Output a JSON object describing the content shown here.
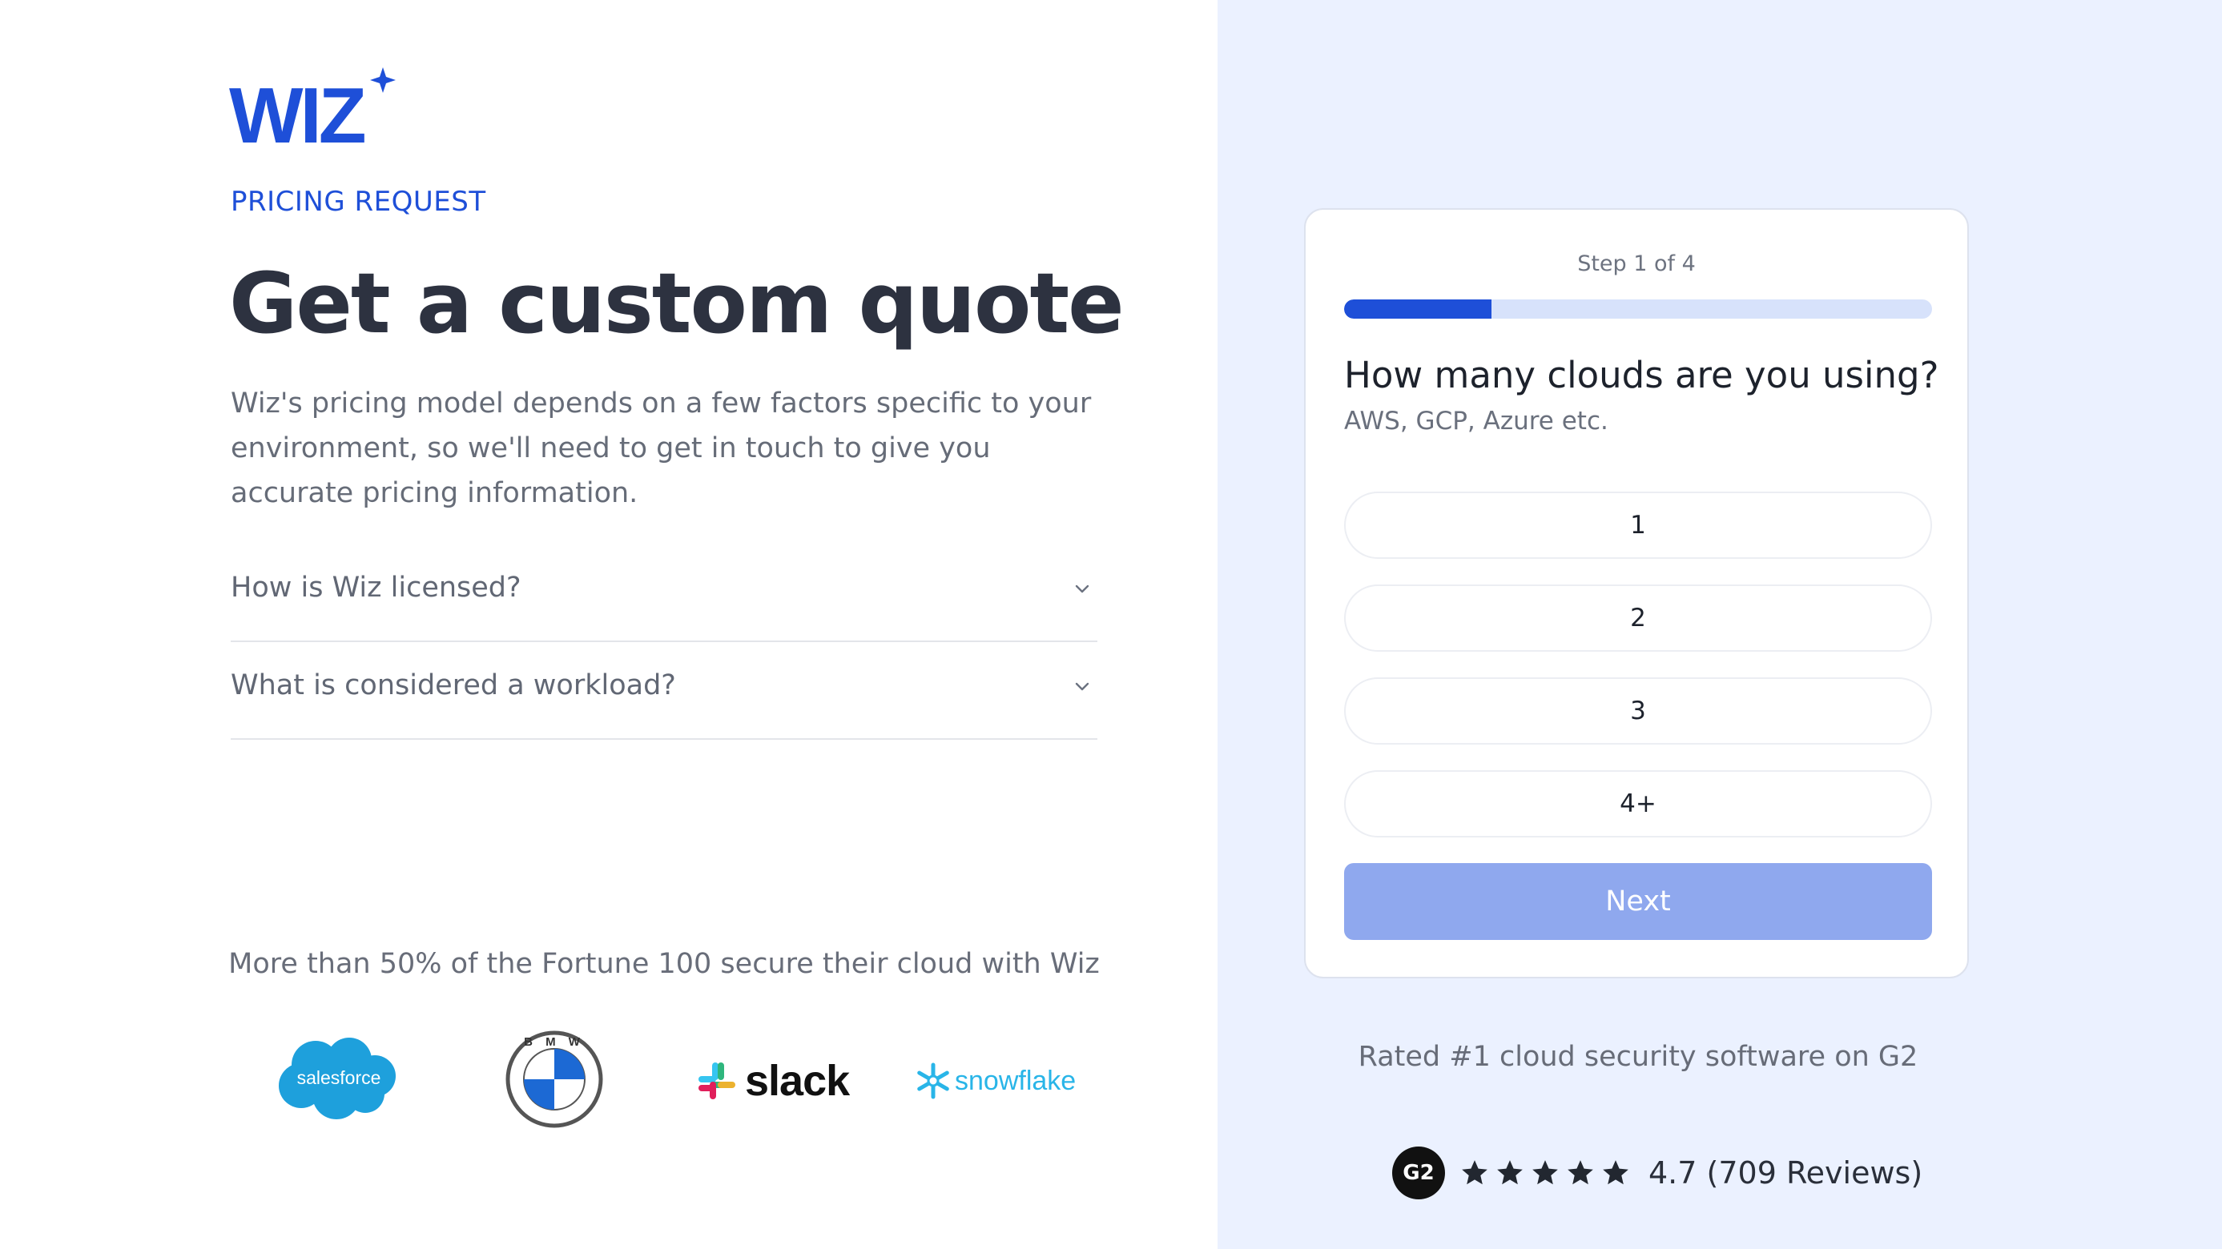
{
  "brand": {
    "logo_text": "WIZ",
    "accent": "#1e4fd8"
  },
  "hero": {
    "eyebrow": "PRICING REQUEST",
    "title": "Get a custom quote",
    "description": "Wiz's pricing model depends on a few factors specific to your environment, so we'll need to get in touch to give you accurate pricing information."
  },
  "faq": [
    {
      "question": "How is Wiz licensed?",
      "icon": "chevron-down-icon"
    },
    {
      "question": "What is considered a workload?",
      "icon": "chevron-down-icon"
    }
  ],
  "trust": {
    "text": "More than 50% of the Fortune 100 secure their cloud with Wiz",
    "logos": [
      {
        "name": "salesforce",
        "label": "salesforce"
      },
      {
        "name": "bmw",
        "label": "B M W"
      },
      {
        "name": "slack",
        "label": "slack"
      },
      {
        "name": "snowflake",
        "label": "snowflake"
      }
    ]
  },
  "form": {
    "step": "Step 1 of 4",
    "progress": 0.25,
    "question": "How many clouds are you using?",
    "hint": "AWS, GCP, Azure etc.",
    "options": [
      "1",
      "2",
      "3",
      "4+"
    ],
    "next_label": "Next",
    "next_color": "#8fa8ee"
  },
  "reviews": {
    "rated_text": "Rated #1 cloud security software on G2",
    "g2_badge": "G2",
    "stars": 5,
    "score_text": "4.7 (709 Reviews)"
  }
}
